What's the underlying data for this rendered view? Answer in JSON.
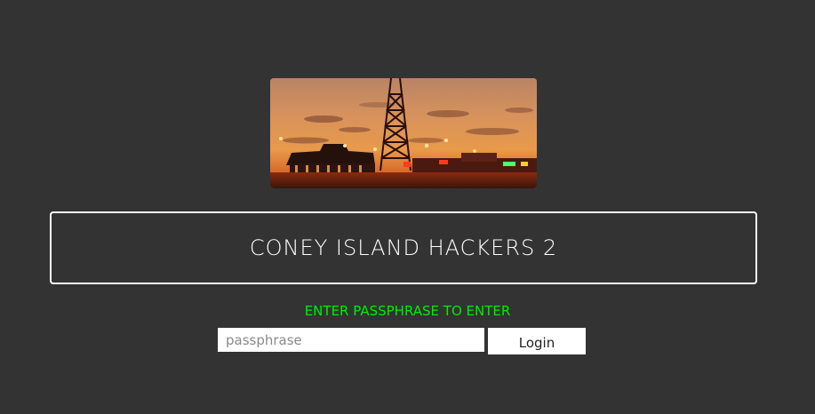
{
  "banner": {
    "image_name": "coney-island-sunset-parachute-jump"
  },
  "header": {
    "title": "CONEY ISLAND HACKERS 2"
  },
  "login": {
    "prompt": "ENTER PASSPHRASE TO ENTER",
    "input_value": "",
    "input_placeholder": "passphrase",
    "button_label": "Login"
  },
  "colors": {
    "background": "#333333",
    "prompt_text": "#00ee00",
    "title_text": "#ffffff",
    "title_border": "#ffffff"
  }
}
